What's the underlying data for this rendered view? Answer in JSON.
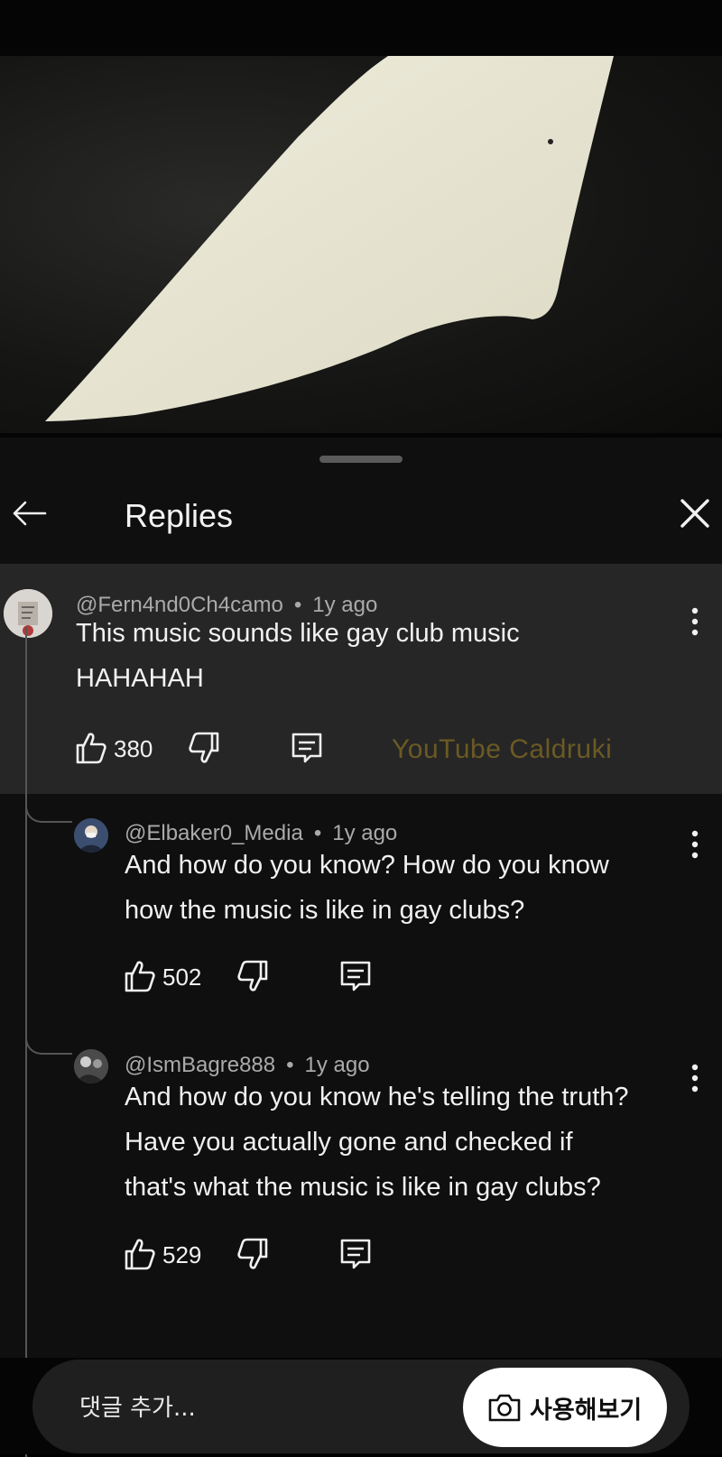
{
  "header": {
    "title": "Replies"
  },
  "watermark": "YouTube Caldruki",
  "parent_comment": {
    "author": "@Fern4nd0Ch4camo",
    "time": "1y ago",
    "text": "This music sounds like gay club music\nHAHAHAH",
    "likes": "380"
  },
  "replies": [
    {
      "author": "@Elbaker0_Media",
      "time": "1y ago",
      "text": "And how do you know? How do you know\nhow the music is like in gay clubs?",
      "likes": "502"
    },
    {
      "author": "@IsmBagre888",
      "time": "1y ago",
      "text": "And how do you know he's telling the truth?\nHave you actually gone and checked if\nthat's what the music is like in gay clubs?",
      "likes": "529"
    }
  ],
  "footer": {
    "comment_placeholder": "댓글 추가...",
    "try_button_label": "사용해보기"
  },
  "colors": {
    "background": "#0f0f0f",
    "highlighted_comment": "#262626",
    "watermark": "#6b5a24"
  },
  "icons": [
    "back-arrow-icon",
    "close-icon",
    "more-vert-icon",
    "thumb-up-icon",
    "thumb-down-icon",
    "reply-icon",
    "camera-icon"
  ]
}
